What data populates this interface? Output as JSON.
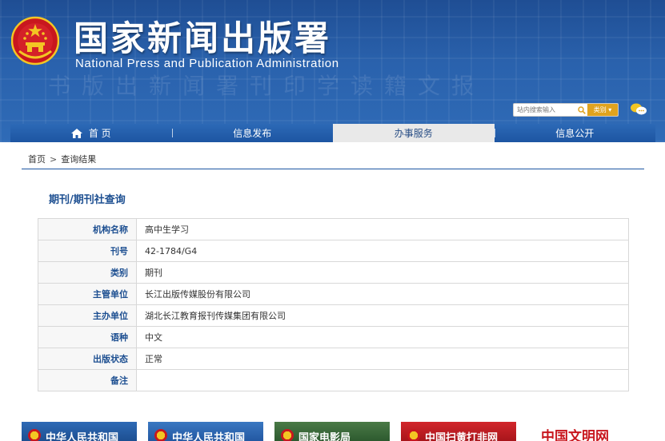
{
  "header": {
    "title": "国家新闻出版署",
    "subtitle": "National  Press and Publication Administration",
    "background_glyphs": "书版出新闻署刊印学读籍文报"
  },
  "search": {
    "placeholder": "站内搜索输入",
    "category_label": "类别 ▾"
  },
  "nav": {
    "items": [
      {
        "label": "首 页"
      },
      {
        "label": "信息发布"
      },
      {
        "label": "办事服务"
      },
      {
        "label": "信息公开"
      }
    ],
    "active_index": 2
  },
  "breadcrumb": {
    "home": "首页",
    "separator": ">",
    "current": "查询结果"
  },
  "page_title": "期刊/期刊社查询",
  "table": {
    "rows": [
      {
        "label": "机构名称",
        "value": "高中生学习"
      },
      {
        "label": "刊号",
        "value": "42-1784/G4"
      },
      {
        "label": "类别",
        "value": "期刊"
      },
      {
        "label": "主管单位",
        "value": "长江出版传媒股份有限公司"
      },
      {
        "label": "主办单位",
        "value": "湖北长江教育报刊传媒集团有限公司"
      },
      {
        "label": "语种",
        "value": "中文"
      },
      {
        "label": "出版状态",
        "value": "正常"
      },
      {
        "label": "备注",
        "value": ""
      }
    ]
  },
  "banners": [
    {
      "label": "中华人民共和国"
    },
    {
      "label": "中华人民共和国"
    },
    {
      "label": "国家电影局"
    },
    {
      "label": "中国扫黄打非网"
    },
    {
      "label": "中国文明网"
    }
  ],
  "colors": {
    "brand_blue": "#1d55a2",
    "label_blue": "#1d4f91",
    "accent_orange": "#e0a31e"
  }
}
